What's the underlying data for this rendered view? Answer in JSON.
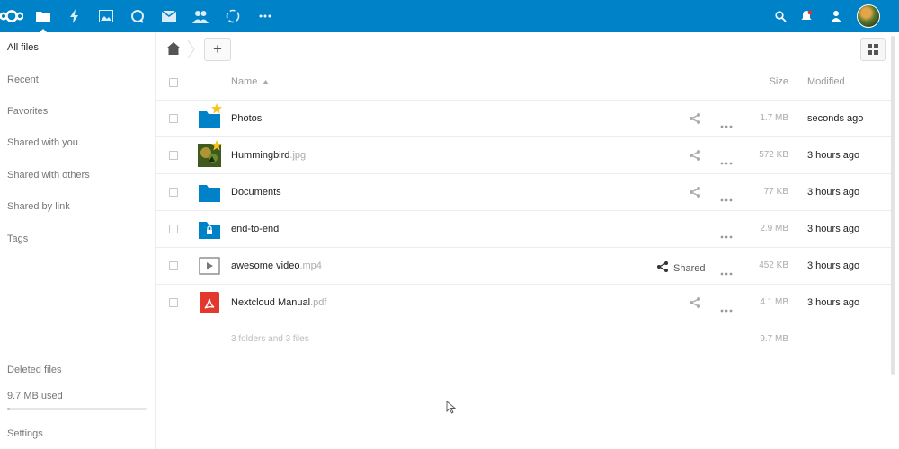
{
  "header": {
    "apps": [
      {
        "name": "files-icon",
        "active": true
      },
      {
        "name": "activity-icon"
      },
      {
        "name": "gallery-icon"
      },
      {
        "name": "talk-icon"
      },
      {
        "name": "mail-icon"
      },
      {
        "name": "contacts-icon"
      },
      {
        "name": "circles-icon"
      },
      {
        "name": "more-apps-icon"
      }
    ],
    "accent_color": "#0082c9"
  },
  "sidebar": {
    "items": [
      {
        "label": "All files"
      },
      {
        "label": "Recent"
      },
      {
        "label": "Favorites"
      },
      {
        "label": "Shared with you"
      },
      {
        "label": "Shared with others"
      },
      {
        "label": "Shared by link"
      },
      {
        "label": "Tags"
      }
    ],
    "deleted_files": "Deleted files",
    "quota_used": "9.7 MB used",
    "quota_fraction": 0.02,
    "settings": "Settings"
  },
  "controls": {
    "add_label": "+"
  },
  "table": {
    "col_name": "Name",
    "col_size": "Size",
    "col_modified": "Modified",
    "rows": [
      {
        "name": "Photos",
        "ext": "",
        "icon": "folder-icon",
        "starred": true,
        "size": "1.7 MB",
        "modified": "seconds ago",
        "shared": false,
        "shareable": true
      },
      {
        "name": "Hummingbird",
        "ext": ".jpg",
        "icon": "image-thumbnail",
        "starred": true,
        "size": "572 KB",
        "modified": "3 hours ago",
        "shared": false,
        "shareable": true
      },
      {
        "name": "Documents",
        "ext": "",
        "icon": "folder-icon",
        "starred": false,
        "size": "77 KB",
        "modified": "3 hours ago",
        "shared": false,
        "shareable": true
      },
      {
        "name": "end-to-end",
        "ext": "",
        "icon": "encrypted-folder-icon",
        "starred": false,
        "size": "2.9 MB",
        "modified": "3 hours ago",
        "shared": false,
        "shareable": false
      },
      {
        "name": "awesome video",
        "ext": ".mp4",
        "icon": "video-icon",
        "starred": false,
        "size": "452 KB",
        "modified": "3 hours ago",
        "shared": true,
        "shareable": true
      },
      {
        "name": "Nextcloud Manual",
        "ext": ".pdf",
        "icon": "pdf-icon",
        "starred": false,
        "size": "4.1 MB",
        "modified": "3 hours ago",
        "shared": false,
        "shareable": true
      }
    ],
    "shared_label": "Shared",
    "summary": "3 folders and 3 files",
    "summary_size": "9.7 MB"
  }
}
